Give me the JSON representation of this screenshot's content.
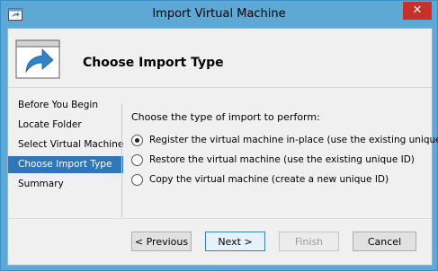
{
  "window": {
    "title": "Import Virtual Machine",
    "close_glyph": "✕"
  },
  "header": {
    "title": "Choose Import Type",
    "icon": "import-arrow-window-icon"
  },
  "sidebar": {
    "items": [
      {
        "label": "Before You Begin",
        "active": false
      },
      {
        "label": "Locate Folder",
        "active": false
      },
      {
        "label": "Select Virtual Machine",
        "active": false
      },
      {
        "label": "Choose Import Type",
        "active": true
      },
      {
        "label": "Summary",
        "active": false
      }
    ]
  },
  "main": {
    "prompt": "Choose the type of import to perform:",
    "options": [
      {
        "label": "Register the virtual machine in-place (use the existing unique ID)",
        "checked": true
      },
      {
        "label": "Restore the virtual machine (use the existing unique ID)",
        "checked": false
      },
      {
        "label": "Copy the virtual machine (create a new unique ID)",
        "checked": false
      }
    ]
  },
  "buttons": {
    "previous": "< Previous",
    "next": "Next >",
    "finish": "Finish",
    "cancel": "Cancel"
  },
  "colors": {
    "titlebar": "#5ea8d6",
    "selection": "#2f77b9",
    "close": "#c7312a"
  }
}
